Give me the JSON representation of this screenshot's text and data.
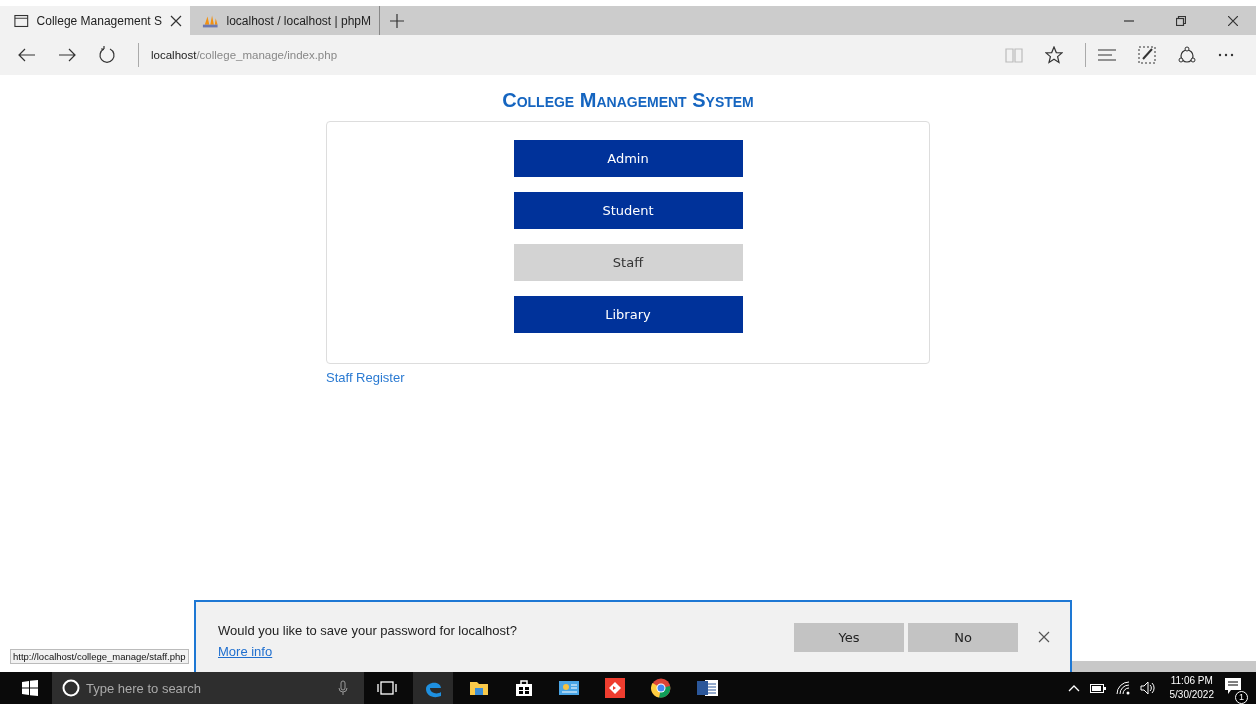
{
  "tabs": [
    {
      "title": "College Management S",
      "selected": true,
      "kind": "page"
    },
    {
      "title": "localhost / localhost | phpM",
      "selected": false,
      "kind": "pma"
    }
  ],
  "address_bar": {
    "host": "localhost",
    "path": "/college_manage/index.php"
  },
  "page": {
    "title": "College Management System",
    "buttons": [
      {
        "label": "Admin",
        "hovered": false
      },
      {
        "label": "Student",
        "hovered": false
      },
      {
        "label": "Staff",
        "hovered": true
      },
      {
        "label": "Library",
        "hovered": false
      }
    ],
    "link": "Staff Register"
  },
  "password_prompt": {
    "message": "Would you like to save your password for localhost?",
    "link": "More info",
    "buttons": [
      "Yes",
      "No"
    ]
  },
  "status_url": "http://localhost/college_manage/staff.php",
  "taskbar": {
    "search_placeholder": "Type here to search",
    "time": "11:06 PM",
    "date": "5/30/2022",
    "notifications": "1"
  }
}
